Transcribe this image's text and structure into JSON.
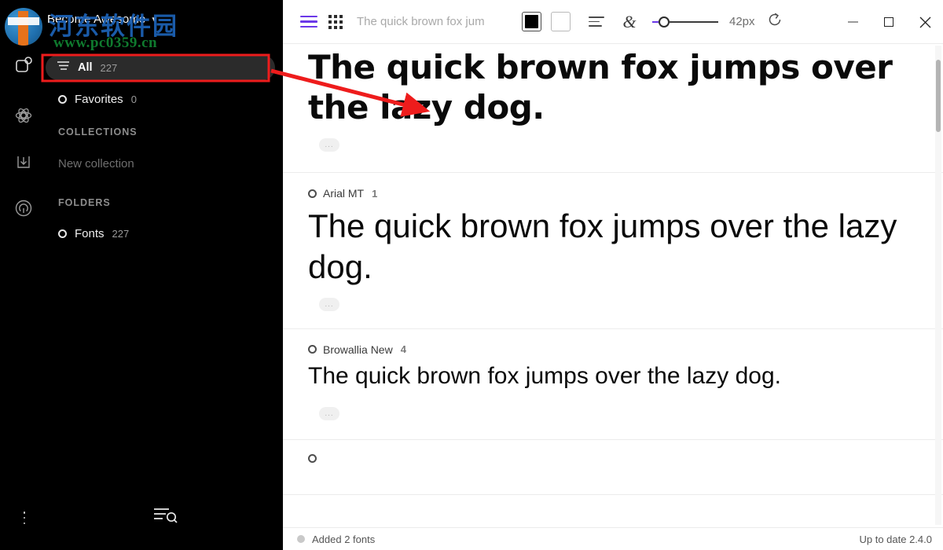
{
  "sidebar": {
    "account": {
      "name": "Become Awesome",
      "chevron": "chevron-down-icon"
    },
    "watermark": {
      "cn_text": "河东软件园",
      "url": "www.pc0359.cn"
    },
    "rail_icons": [
      "shape-badge-icon",
      "atom-icon",
      "download-icon",
      "radar-icon"
    ],
    "nav": [
      {
        "label": "All",
        "count": "227",
        "icon": "list-lines-icon",
        "selected": true
      },
      {
        "label": "Favorites",
        "count": "0",
        "icon": "circle-icon",
        "selected": false
      }
    ],
    "collections": {
      "heading": "COLLECTIONS",
      "new_label": "New collection"
    },
    "folders": {
      "heading": "FOLDERS",
      "items": [
        {
          "label": "Fonts",
          "count": "227",
          "icon": "circle-icon"
        }
      ]
    },
    "bottom": {
      "menu_icon": "more-vertical-icon",
      "search_icon": "list-search-icon"
    }
  },
  "toolbar": {
    "view_list_icon": "list-view-icon",
    "view_grid_icon": "grid-view-icon",
    "sample_text": "The quick brown fox jum",
    "sample_placeholder": "The quick brown fox jumps over the lazy dog.",
    "swatch_fg": "#000000",
    "swatch_bg": "#ffffff",
    "align_icon": "align-left-icon",
    "glyph_icon": "ampersand-icon",
    "glyph_char": "&",
    "slider_icon": "size-slider",
    "size_label": "42px",
    "reset_icon": "reset-icon",
    "accent_color": "#6b38e8",
    "window": {
      "minimize": "minimize-icon",
      "maximize": "maximize-icon",
      "close": "close-icon"
    }
  },
  "fonts": [
    {
      "name": "",
      "styles": "",
      "preview": "The quick brown fox jumps over the lazy dog.",
      "more": "..."
    },
    {
      "name": "Arial MT",
      "styles": "1",
      "preview": "The quick brown fox jumps over the lazy dog.",
      "more": "..."
    },
    {
      "name": "Browallia New",
      "styles": "4",
      "preview": "The quick brown fox jumps over the lazy dog.",
      "more": "..."
    }
  ],
  "statusbar": {
    "message": "Added 2 fonts",
    "version": "Up to date 2.4.0"
  },
  "annotation": {
    "highlight_color": "#ee1c1c",
    "target": "All"
  }
}
